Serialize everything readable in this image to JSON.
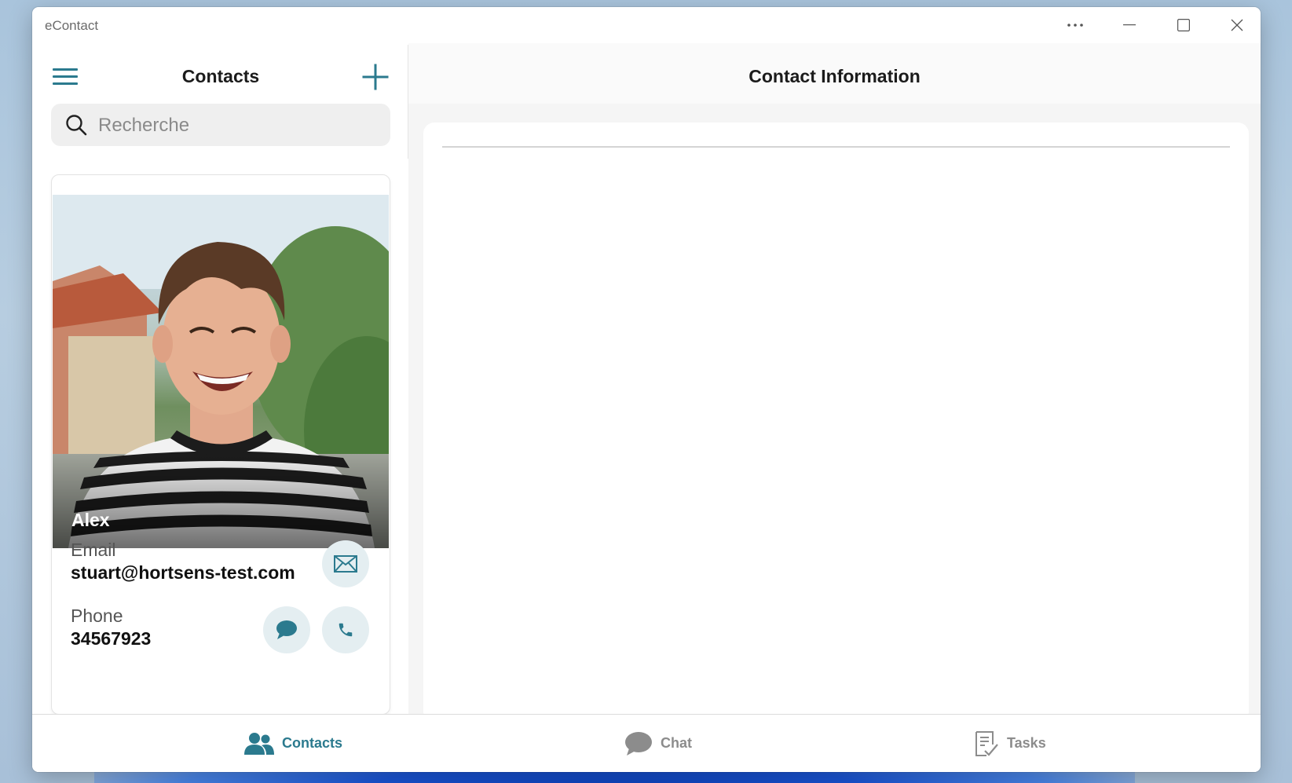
{
  "window": {
    "title": "eContact",
    "controls": [
      "more-icon",
      "minimize-icon",
      "maximize-icon",
      "close-icon"
    ]
  },
  "left_pane": {
    "title": "Contacts",
    "menu_icon": "hamburger-menu-icon",
    "add_icon": "plus-icon",
    "search": {
      "placeholder": "Recherche",
      "value": "",
      "icon": "search-icon"
    }
  },
  "contact_card": {
    "name": "Alex",
    "email_label": "Email",
    "email_value": "stuart@hortsens-test.com",
    "phone_label": "Phone",
    "phone_value": "34567923",
    "actions": [
      "mail-icon",
      "message-icon",
      "phone-icon"
    ]
  },
  "right_pane": {
    "title": "Contact Information"
  },
  "bottom_nav": {
    "tabs": [
      {
        "label": "Contacts",
        "icon": "people-icon",
        "active": true
      },
      {
        "label": "Chat",
        "icon": "chat-bubble-icon",
        "active": false
      },
      {
        "label": "Tasks",
        "icon": "tasks-icon",
        "active": false
      }
    ]
  },
  "colors": {
    "accent": "#2b7a8e",
    "inactive": "#8c8c8c",
    "button_bg": "#e4eef1"
  }
}
